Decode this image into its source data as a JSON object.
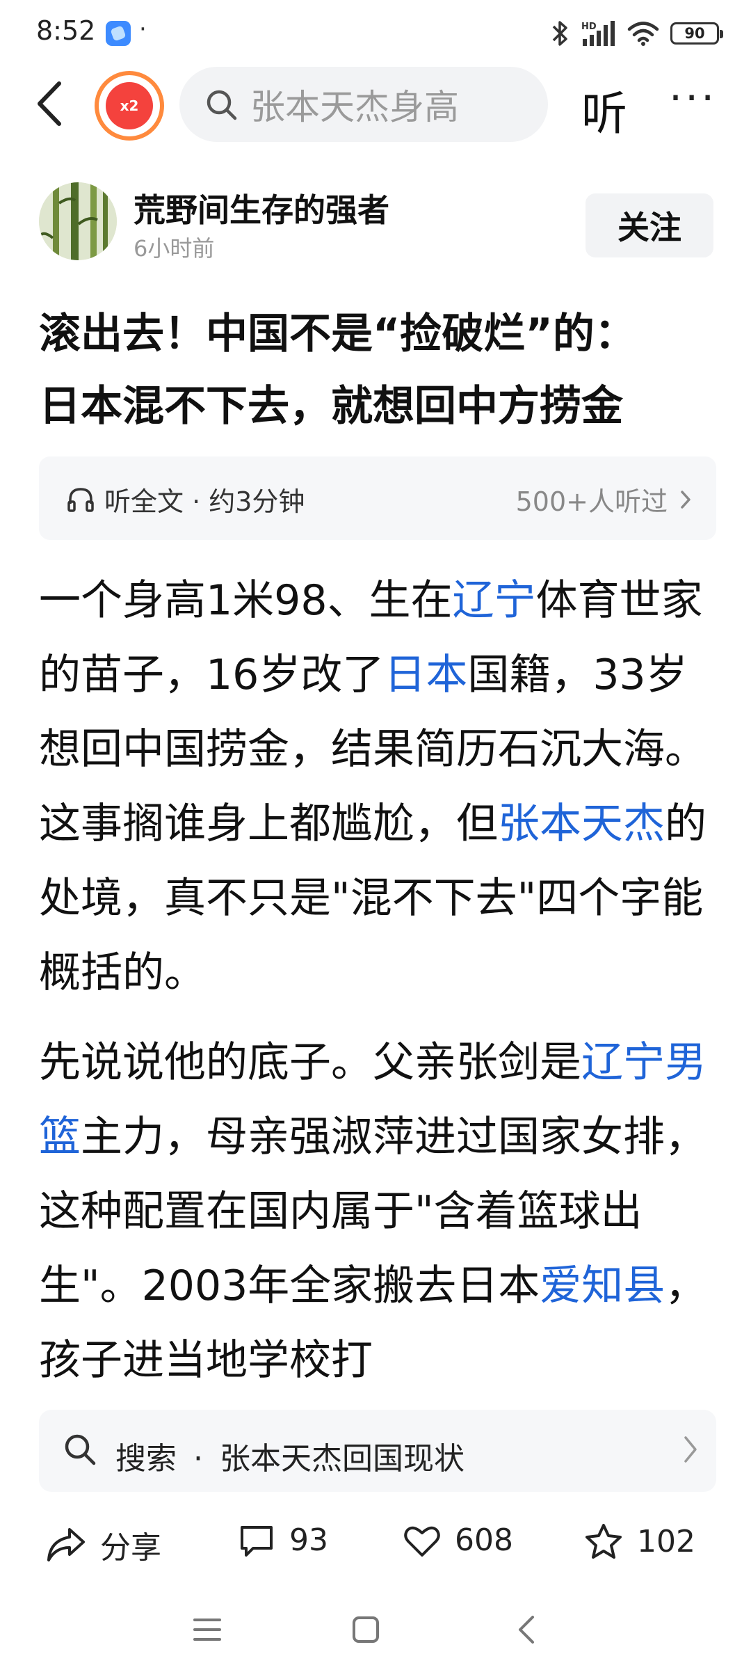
{
  "status_bar": {
    "time": "8:52",
    "dot": "·",
    "network_label": "HD",
    "battery": "90"
  },
  "nav": {
    "coin_label": "x2",
    "search_placeholder": "张本天杰身高",
    "listen_label": "听",
    "more_label": "···"
  },
  "author": {
    "name": "荒野间生存的强者",
    "time": "6小时前",
    "follow_label": "关注"
  },
  "article": {
    "title_line1": "滚出去！中国不是“捡破烂”的：",
    "title_line2": "日本混不下去，就想回中方捞金",
    "listen_full": "听全文 · 约3分钟",
    "listen_count": "500+人听过",
    "p1": {
      "t1": "一个身高1米98、生在",
      "l1": "辽宁",
      "t2": "体育世家的苗子，16岁改了",
      "l2": "日本",
      "t3": "国籍，33岁想回中国捞金，结果简历石沉大海。这事搁谁身上都尴尬，但",
      "l3": "张本天杰",
      "t4": "的处境，真不只是\"混不下去\"四个字能概括的。"
    },
    "p2": {
      "t1": "先说说他的底子。父亲张剑是",
      "l1": "辽宁男篮",
      "t2": "主力，母亲强淑萍进过国家女排，这种配置在国内属于\"含着篮球出生\"。2003年全家搬去日本",
      "l2": "爱知县",
      "t3": "，孩子进当地学校打"
    }
  },
  "search_suggest": {
    "label": "搜索",
    "separator": "·",
    "query": "张本天杰回国现状"
  },
  "actions": {
    "share": "分享",
    "comments": "93",
    "likes": "608",
    "favorites": "102"
  },
  "colors": {
    "link": "#1f64d8",
    "accent_orange": "#ff8a3d",
    "accent_red": "#f4423d"
  }
}
